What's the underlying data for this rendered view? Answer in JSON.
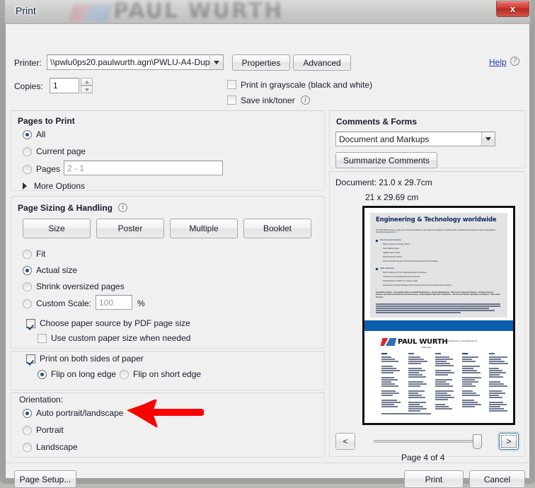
{
  "window": {
    "title": "Print",
    "close_label": "x",
    "background_watermark": "PAUL WURTH"
  },
  "printer": {
    "label": "Printer:",
    "value": "\\\\pwlu0ps20.paulwurth.agn\\PWLU-A4-Dup",
    "properties_label": "Properties",
    "advanced_label": "Advanced",
    "help_label": "Help",
    "help_icon": "question-circle-icon"
  },
  "copies": {
    "label": "Copies:",
    "value": "1"
  },
  "print_options": {
    "grayscale_label": "Print in grayscale (black and white)",
    "grayscale_checked": false,
    "save_ink_label": "Save ink/toner",
    "save_ink_checked": false,
    "save_ink_info_icon": "info-icon"
  },
  "pages_to_print": {
    "title": "Pages to Print",
    "options": [
      {
        "label": "All",
        "selected": true
      },
      {
        "label": "Current page",
        "selected": false
      },
      {
        "label": "Pages",
        "selected": false
      }
    ],
    "pages_value": "2 - 1",
    "more_options_label": "More Options",
    "more_options_icon": "triangle-right-icon"
  },
  "page_sizing": {
    "title": "Page Sizing & Handling",
    "info_icon": "info-icon",
    "buttons": [
      {
        "label": "Size"
      },
      {
        "label": "Poster"
      },
      {
        "label": "Multiple"
      },
      {
        "label": "Booklet"
      }
    ],
    "options": [
      {
        "label": "Fit",
        "selected": false
      },
      {
        "label": "Actual size",
        "selected": true
      },
      {
        "label": "Shrink oversized pages",
        "selected": false
      },
      {
        "label": "Custom Scale:",
        "selected": false
      }
    ],
    "custom_scale_value": "100",
    "percent_label": "%",
    "choose_paper_source_label": "Choose paper source by PDF page size",
    "choose_paper_source_checked": true,
    "custom_paper_size_label": "Use custom paper size when needed",
    "custom_paper_size_checked": false
  },
  "duplex": {
    "both_sides_label": "Print on both sides of paper",
    "both_sides_checked": true,
    "flip_long_label": "Flip on long edge",
    "flip_long_selected": true,
    "flip_short_label": "Flip on short edge",
    "flip_short_selected": false
  },
  "orientation": {
    "title": "Orientation:",
    "options": [
      {
        "label": "Auto portrait/landscape",
        "selected": true
      },
      {
        "label": "Portrait",
        "selected": false
      },
      {
        "label": "Landscape",
        "selected": false
      }
    ]
  },
  "comments_forms": {
    "title": "Comments & Forms",
    "selected": "Document and Markups",
    "summarize_label": "Summarize Comments"
  },
  "document_info": {
    "document_size": "Document: 21.0 x 29.7cm",
    "paper_size": "21 x 29.69 cm"
  },
  "preview": {
    "heading": "Engineering & Technology worldwide",
    "intro": "The Paul Wurth Group is today one of the world leaders in the design and supply of complete plants, systems and processes as well as specialised mechanical equipment for",
    "section1_title": "the iron & steel industry:",
    "section1_items": [
      "Blast Furnaces & Auxiliary Plants",
      "Coke Making Plants",
      "Agglomeration Plants",
      "Direct Reduction Plants",
      "Environmental Protection, Recycling & Energy-Saving Technologies"
    ],
    "section2_title": "other industries:",
    "section2_items": [
      "Niche Solutions for Oil & Gas Downstream Processes",
      "Solutions for Decentralised Energy Production",
      "Interdisciplinary Solutions for Heavy Loads",
      "Engineering & Project Management for Civil Construction and Infrastructure Projects"
    ],
    "services_line": "Feasibility Studies - Conceptual, Basic and Detail Engineering - Project Management - Plant and Component Supply - Turnkey Projects - Erection and Site Assembly and Commissioning - Technological Operation Assistance - Service and Spares Operation Assistance - After-sales Services",
    "logo_text": "PAUL WURTH",
    "logo_subtext": "SMS group",
    "contact_line": "mail@paulwurth.com • www.paulwurth.com"
  },
  "pager": {
    "prev_label": "<",
    "next_label": ">",
    "page_status": "Page 4 of 4"
  },
  "footer": {
    "page_setup_label": "Page Setup...",
    "print_label": "Print",
    "cancel_label": "Cancel"
  },
  "colors": {
    "accent_blue": "#0b5fae",
    "link_blue": "#1a3fb0",
    "annotation_red": "#fb0000",
    "close_red": "#cf3b31"
  }
}
